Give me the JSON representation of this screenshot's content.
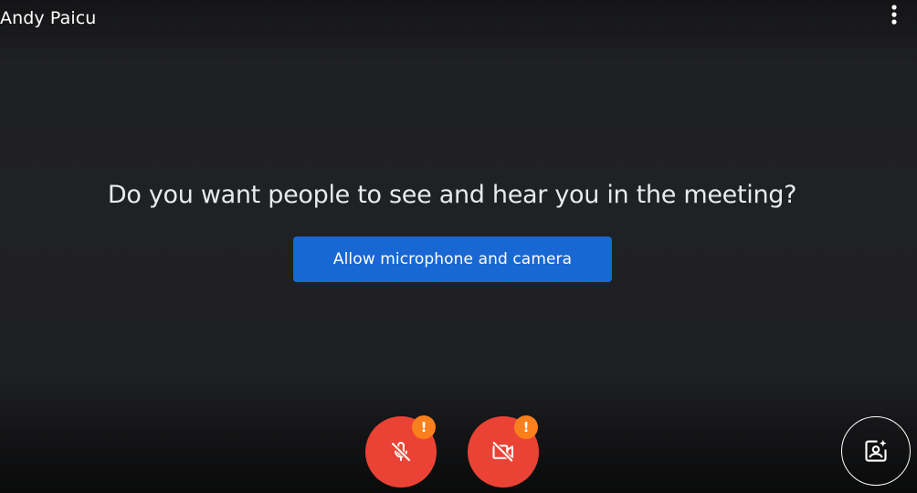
{
  "participant": {
    "name": "Andy Paicu"
  },
  "header": {
    "more_icon": "more-vert-icon"
  },
  "permission": {
    "question": "Do you want people to see and hear you in the meeting?",
    "allow_button_label": "Allow microphone and camera"
  },
  "controls": {
    "microphone": {
      "state": "off",
      "icon": "mic-off-icon",
      "warning_badge": "!"
    },
    "camera": {
      "state": "off",
      "icon": "videocam-off-icon",
      "warning_badge": "!"
    },
    "effects": {
      "icon": "visual-effects-icon"
    }
  },
  "colors": {
    "background": "#202124",
    "primary_button": "#1967d2",
    "control_off": "#ea4335",
    "warning": "#f9801d",
    "text": "#ffffff"
  }
}
